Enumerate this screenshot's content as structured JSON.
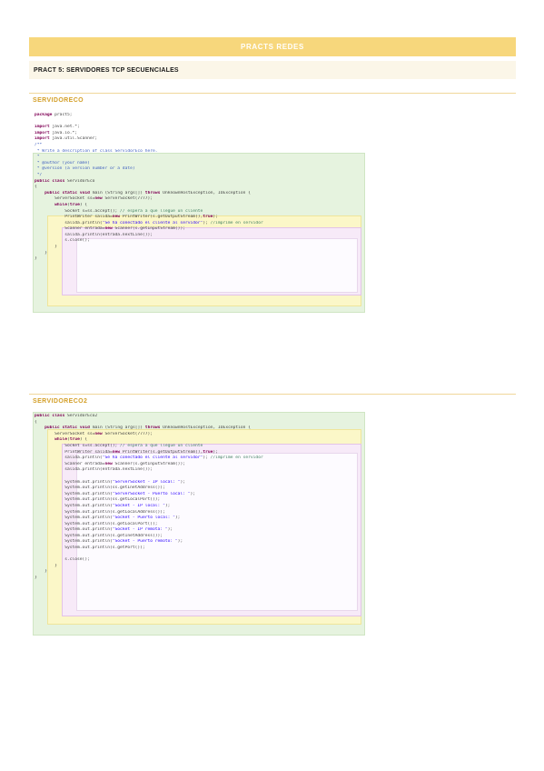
{
  "header": {
    "banner_title": "PRACTS REDES",
    "subtitle": "PRACT 5: SERVIDORES TCP SECUENCIALES"
  },
  "sections": [
    {
      "title": "SERVIDORECO",
      "code_lines": [
        "package pract5;",
        "",
        "import java.net.*;",
        "import java.io.*;",
        "import java.util.Scanner;",
        "/**",
        " * Write a description of class ServidorEco here.",
        " *",
        " * @author (your name)",
        " * @version (a version number or a date)",
        " */",
        "public class ServidorEco",
        "{",
        "    public static void main (String args[]) throws UnknownHostException, IOException {",
        "        ServerSocket ss=new ServerSocket(7777);",
        "        while(true) {",
        "            Socket s=ss.accept(); // espera a que llegue un cliente",
        "            PrintWriter salida=new PrintWriter(s.getOutputStream(),true);",
        "            salida.println(\"Se ha conectado el cliente al servidor\"); //imprime en servidor",
        "            Scanner entrada=new Scanner(s.getInputStream());",
        "            salida.println(entrada.nextLine());",
        "            s.close();",
        "        }",
        "    }",
        "}"
      ]
    },
    {
      "title": "SERVIDORECO2",
      "code_lines": [
        "public class ServidorEco2",
        "{",
        "    public static void main (String args[]) throws UnknownHostException, IOException {",
        "        ServerSocket ss=new ServerSocket(7777);",
        "        while(true) {",
        "            Socket s=ss.accept(); // espera a que llegue un cliente",
        "            PrintWriter salida=new PrintWriter(s.getOutputStream(),true);",
        "            salida.println(\"Se ha conectado el cliente al servidor\"); //imprime en servidor",
        "            Scanner entrada=new Scanner(s.getInputStream());",
        "            salida.println(entrada.nextLine());",
        "",
        "            System.out.println(\"ServerSocket - IP local: \");",
        "            System.out.println(ss.getInetAddress());",
        "            System.out.println(\"ServerSocket - Puerto local: \");",
        "            System.out.println(ss.getLocalPort());",
        "            System.out.println(\"Socket - IP local: \");",
        "            System.out.println(s.getLocalAddress());",
        "            System.out.println(\"Socket - Puerto local: \");",
        "            System.out.println(s.getLocalPort());",
        "            System.out.println(\"Socket - IP remota: \");",
        "            System.out.println(s.getInetAddress());",
        "            System.out.println(\"Socket - Puerto remoto: \");",
        "            System.out.println(s.getPort());",
        "",
        "            s.close();",
        "        }",
        "    }",
        "}"
      ]
    }
  ],
  "colors": {
    "banner": "#f7d77c",
    "section_title": "#d4a02a",
    "class_block": "#e6f3df",
    "method_block": "#fbf7c8",
    "loop_block": "#f7eaf8"
  }
}
